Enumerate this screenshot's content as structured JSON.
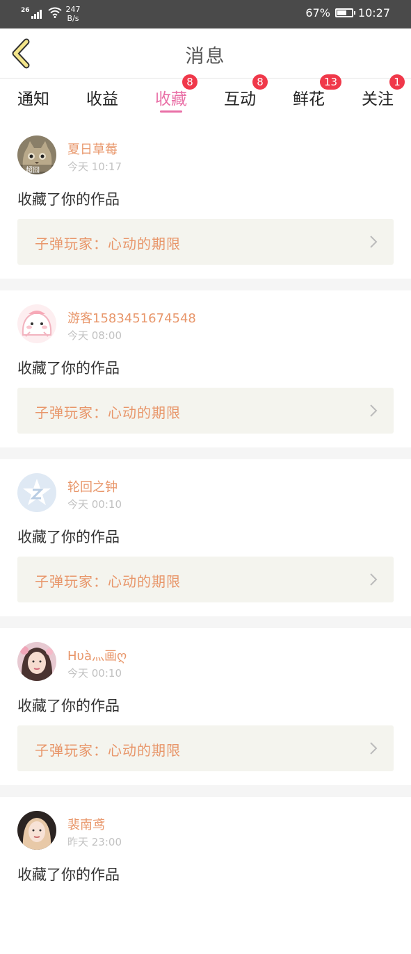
{
  "status_bar": {
    "network": "26",
    "speed_value": "247",
    "speed_unit": "B/s",
    "battery": "67%",
    "time": "10:27",
    "battery_level": 0.67
  },
  "header": {
    "title": "消息",
    "back_icon": "chevron-left-icon"
  },
  "tabs": [
    {
      "label": "通知",
      "badge": ""
    },
    {
      "label": "收益",
      "badge": ""
    },
    {
      "label": "收藏",
      "badge": "8",
      "active": true
    },
    {
      "label": "互动",
      "badge": "8"
    },
    {
      "label": "鲜花",
      "badge": "13"
    },
    {
      "label": "关注",
      "badge": "1"
    }
  ],
  "colors": {
    "accent": "#e96fa6",
    "username": "#e8966a",
    "badge": "#f0384a",
    "card_bg": "#f4f4ee"
  },
  "items": [
    {
      "user": "夏日草莓",
      "time": "今天 10:17",
      "action": "收藏了你的作品",
      "work": "子弹玩家：心动的期限",
      "avatar_label": "超囧"
    },
    {
      "user": "游客1583451674548",
      "time": "今天 08:00",
      "action": "收藏了你的作品",
      "work": "子弹玩家：心动的期限"
    },
    {
      "user": "轮回之钟",
      "time": "今天 00:10",
      "action": "收藏了你的作品",
      "work": "子弹玩家：心动的期限"
    },
    {
      "user": "Hυà灬画ღ",
      "time": "今天 00:10",
      "action": "收藏了你的作品",
      "work": "子弹玩家：心动的期限"
    },
    {
      "user": "裴南鸢",
      "time": "昨天 23:00",
      "action": "收藏了你的作品",
      "work": ""
    }
  ]
}
